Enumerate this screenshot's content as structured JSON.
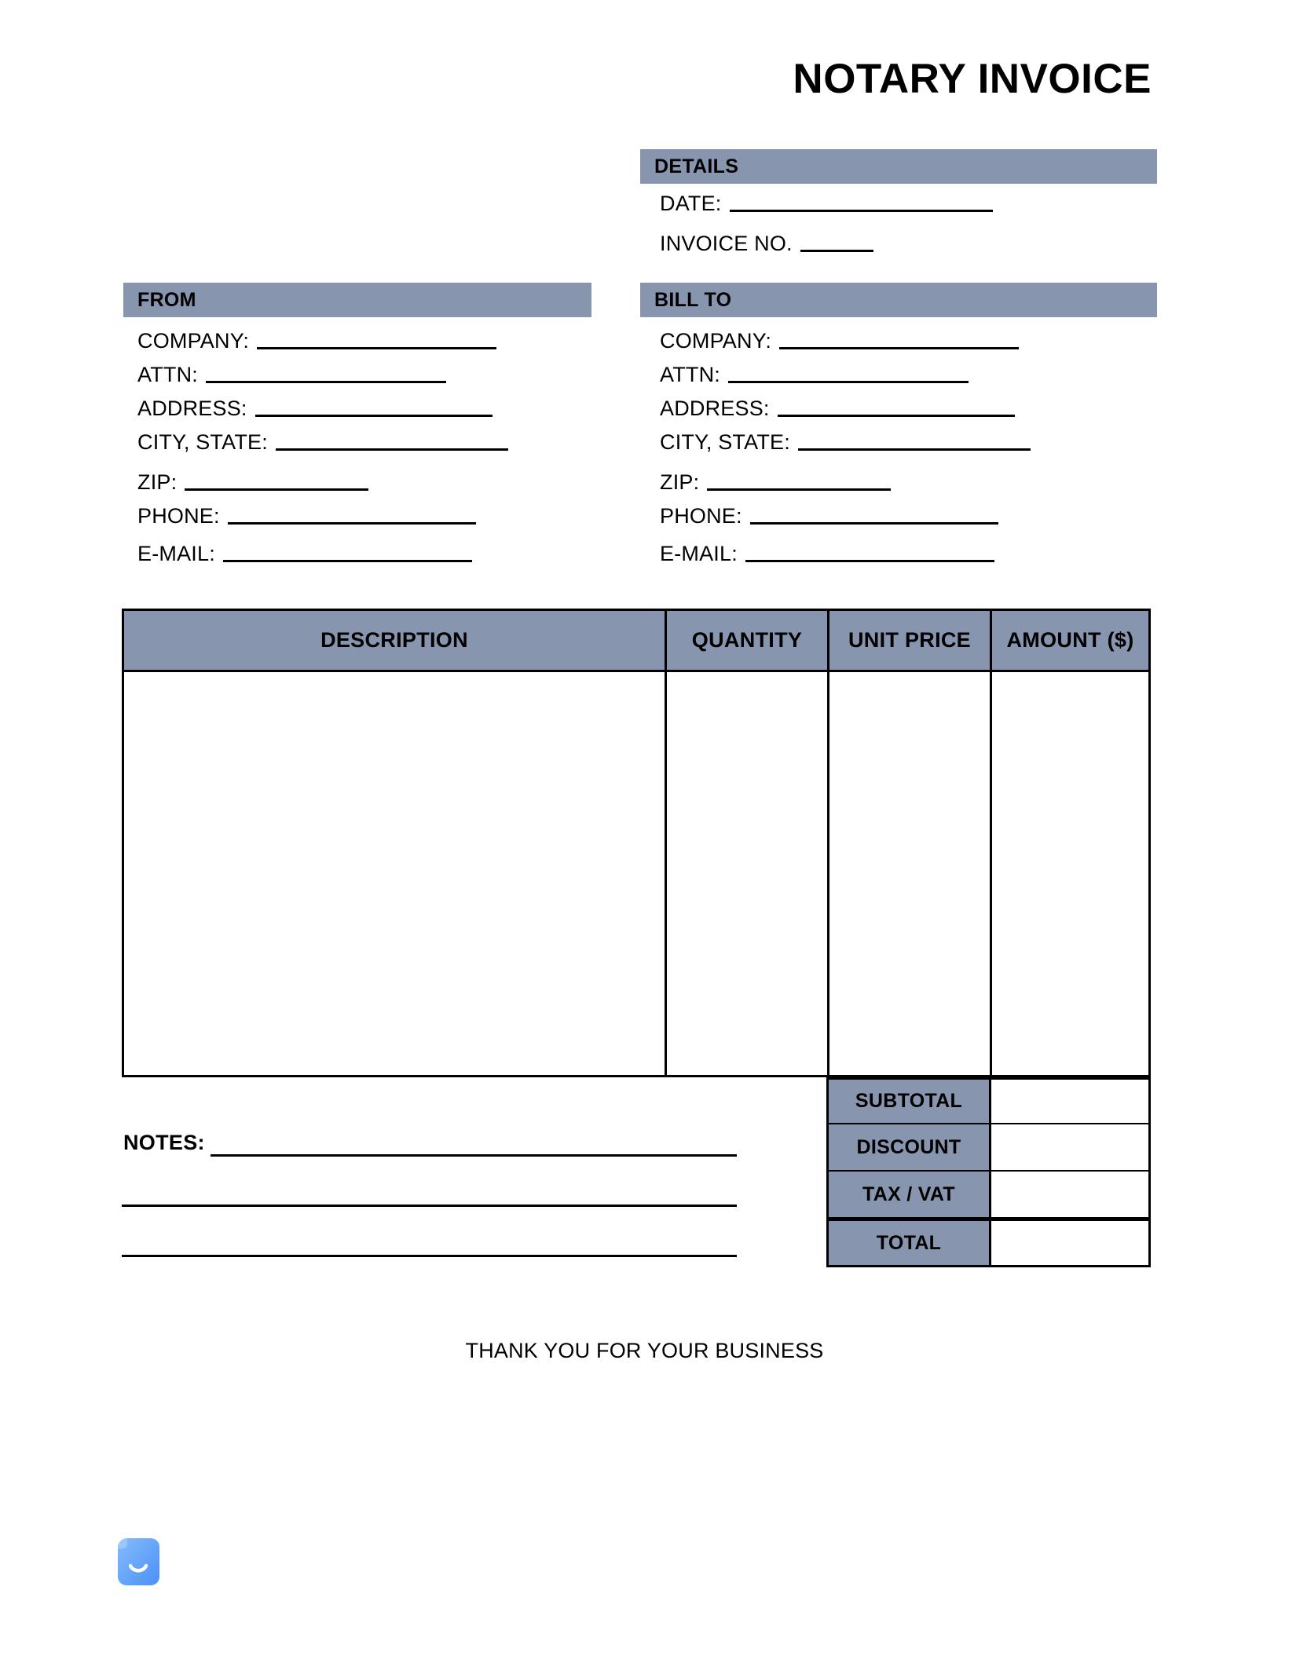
{
  "document": {
    "title": "NOTARY INVOICE"
  },
  "details": {
    "header": "DETAILS",
    "fields": [
      {
        "label": "DATE:",
        "value": "",
        "rule_width": 335
      },
      {
        "label": "INVOICE NO.",
        "value": "",
        "rule_width": 93
      }
    ]
  },
  "from": {
    "header": "FROM",
    "fields": [
      {
        "label": "COMPANY:",
        "value": "",
        "rule_width": 305
      },
      {
        "label": "ATTN:",
        "value": "",
        "rule_width": 306
      },
      {
        "label": "ADDRESS:",
        "value": "",
        "rule_width": 302
      },
      {
        "label": "CITY, STATE:",
        "value": "",
        "rule_width": 296
      },
      {
        "label": "ZIP:",
        "value": "",
        "rule_width": 234
      },
      {
        "label": "PHONE:",
        "value": "",
        "rule_width": 316
      },
      {
        "label": "E-MAIL:",
        "value": "",
        "rule_width": 317
      }
    ]
  },
  "bill_to": {
    "header": "BILL TO",
    "fields": [
      {
        "label": "COMPANY:",
        "value": "",
        "rule_width": 305
      },
      {
        "label": "ATTN:",
        "value": "",
        "rule_width": 306
      },
      {
        "label": "ADDRESS:",
        "value": "",
        "rule_width": 302
      },
      {
        "label": "CITY, STATE:",
        "value": "",
        "rule_width": 296
      },
      {
        "label": "ZIP:",
        "value": "",
        "rule_width": 234
      },
      {
        "label": "PHONE:",
        "value": "",
        "rule_width": 316
      },
      {
        "label": "E-MAIL:",
        "value": "",
        "rule_width": 317
      }
    ]
  },
  "items_table": {
    "columns": [
      "DESCRIPTION",
      "QUANTITY",
      "UNIT PRICE",
      "AMOUNT ($)"
    ],
    "rows": []
  },
  "totals": [
    {
      "label": "SUBTOTAL",
      "value": ""
    },
    {
      "label": "DISCOUNT",
      "value": ""
    },
    {
      "label": "TAX / VAT",
      "value": ""
    },
    {
      "label": "TOTAL",
      "value": ""
    }
  ],
  "notes": {
    "label": "NOTES:",
    "lines": [
      "",
      "",
      ""
    ]
  },
  "footer": {
    "thanks": "THANK YOU FOR YOUR BUSINESS"
  },
  "logo": {
    "name": "document-smile-logo",
    "color_start": "#7cb6fb",
    "color_end": "#4d93f7"
  },
  "colors": {
    "header_bar": "#8795af",
    "border": "#000000",
    "page_background": "#ffffff"
  }
}
